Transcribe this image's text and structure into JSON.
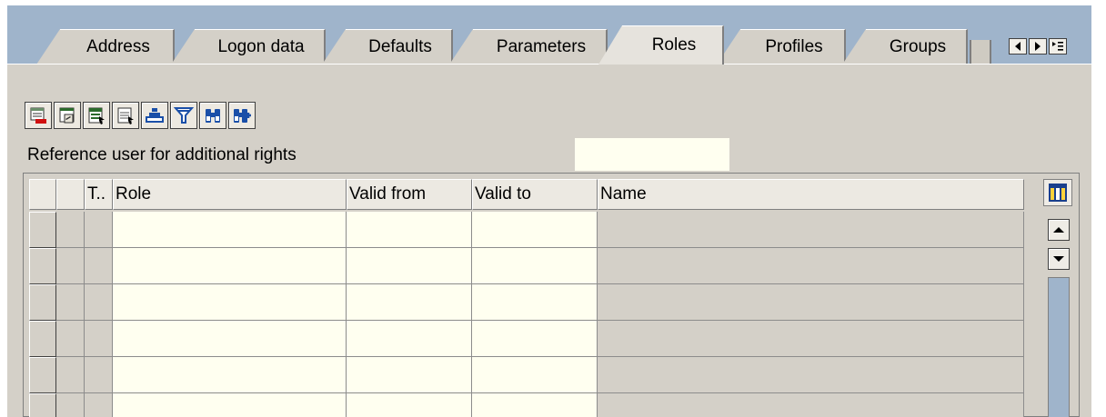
{
  "tabs": [
    {
      "label": "Address",
      "active": false
    },
    {
      "label": "Logon data",
      "active": false
    },
    {
      "label": "Defaults",
      "active": false
    },
    {
      "label": "Parameters",
      "active": false
    },
    {
      "label": "Roles",
      "active": true
    },
    {
      "label": "Profiles",
      "active": false
    },
    {
      "label": "Groups",
      "active": false
    }
  ],
  "tab_nav": {
    "left_icon": "scroll-left-icon",
    "right_icon": "scroll-right-icon",
    "list_icon": "tab-list-icon"
  },
  "toolbar": {
    "buttons": [
      {
        "icon": "delete-row-icon"
      },
      {
        "icon": "change-icon"
      },
      {
        "icon": "select-all-icon"
      },
      {
        "icon": "deselect-all-icon"
      },
      {
        "icon": "sort-icon"
      },
      {
        "icon": "filter-icon"
      },
      {
        "icon": "find-icon"
      },
      {
        "icon": "find-next-icon"
      }
    ]
  },
  "reference": {
    "label": "Reference user for additional rights",
    "value": ""
  },
  "table": {
    "columns": [
      "",
      "",
      "T..",
      "Role",
      "Valid from",
      "Valid to",
      "Name"
    ],
    "rows": [
      {
        "type": "",
        "role": "",
        "valid_from": "",
        "valid_to": "",
        "name": ""
      },
      {
        "type": "",
        "role": "",
        "valid_from": "",
        "valid_to": "",
        "name": ""
      },
      {
        "type": "",
        "role": "",
        "valid_from": "",
        "valid_to": "",
        "name": ""
      },
      {
        "type": "",
        "role": "",
        "valid_from": "",
        "valid_to": "",
        "name": ""
      },
      {
        "type": "",
        "role": "",
        "valid_from": "",
        "valid_to": "",
        "name": ""
      },
      {
        "type": "",
        "role": "",
        "valid_from": "",
        "valid_to": "",
        "name": ""
      }
    ]
  },
  "colors": {
    "tabstrip_bg": "#9fb4cb",
    "panel_bg": "#d4d0c8",
    "input_bg": "#fffff0"
  }
}
